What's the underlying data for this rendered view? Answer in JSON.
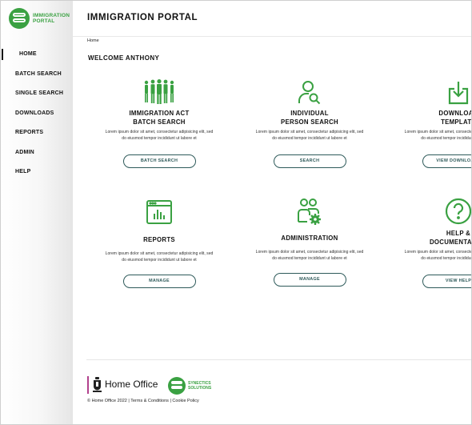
{
  "brand": {
    "logo_text": "IMMIGRATION\nPORTAL",
    "color": "#3aa142"
  },
  "nav": [
    {
      "label": "HOME",
      "active": true
    },
    {
      "label": "BATCH SEARCH"
    },
    {
      "label": "SINGLE SEARCH"
    },
    {
      "label": "DOWNLOADS"
    },
    {
      "label": "REPORTS"
    },
    {
      "label": "ADMIN"
    },
    {
      "label": "HELP"
    }
  ],
  "header": {
    "title": "IMMIGRATION PORTAL",
    "breadcrumb": "Home"
  },
  "welcome": "WELCOME ANTHONY",
  "cards": [
    {
      "title_line1": "IMMIGRATION ACT",
      "title_line2": "BATCH SEARCH",
      "desc": "Lorem ipsum dolor sit amet, consectetur adipisicing elit, sed do eiusmod tempor incididunt ut labore et",
      "button": "BATCH SEARCH",
      "icon": "people-group-icon"
    },
    {
      "title_line1": "INDIVIDUAL",
      "title_line2": "PERSON SEARCH",
      "desc": "Lorem ipsum dolor sit amet, consectetur adipisicing elit, sed do eiusmod tempor incididunt ut labore et",
      "button": "SEARCH",
      "icon": "person-search-icon"
    },
    {
      "title_line1": "DOWNLOAD",
      "title_line2": "TEMPLATE",
      "desc": "Lorem ipsum dolor sit amet, consectetur adipisicing elit, sed do eiusmod tempor incididunt ut labore et",
      "button": "VIEW DOWNLOADS",
      "icon": "download-icon"
    },
    {
      "title_line1": "REPORTS",
      "title_line2": "",
      "desc": "Lorem ipsum dolor sit amet, consectetur adipisicing elit, sed do eiusmod tempor incididunt ut labore et",
      "button": "MANAGE",
      "icon": "report-chart-icon"
    },
    {
      "title_line1": "ADMINISTRATION",
      "title_line2": "",
      "desc": "Lorem ipsum dolor sit amet, consectetur adipisicing elit, sed do eiusmod tempor incididunt ut labore et",
      "button": "MANAGE",
      "icon": "admin-users-gear-icon"
    },
    {
      "title_line1": "HELP &",
      "title_line2": "DOCUMENTATION",
      "desc": "Lorem ipsum dolor sit amet, consectetur adipisicing elit, sed do eiusmod tempor incididunt ut labore et",
      "button": "VIEW HELP",
      "icon": "help-question-icon"
    }
  ],
  "footer": {
    "home_office": "Home Office",
    "synectics": "SYNECTICS\nSOLUTIONS",
    "copyright": "© Home Office 2022",
    "terms": "Terms & Conditions",
    "cookie": "Cookie Policy",
    "separator": "|"
  }
}
